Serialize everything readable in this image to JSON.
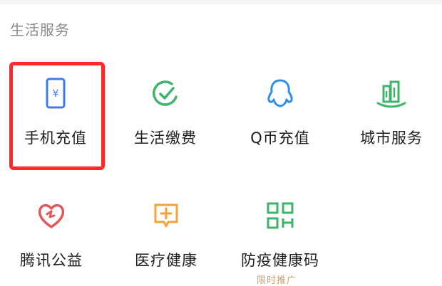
{
  "section": {
    "title": "生活服务"
  },
  "services": [
    {
      "label": "手机充值",
      "icon": "phone-yuan-icon",
      "color": "#3b7cf0"
    },
    {
      "label": "生活缴费",
      "icon": "check-circle-icon",
      "color": "#3fb36a"
    },
    {
      "label": "Q币充值",
      "icon": "qq-penguin-icon",
      "color": "#2f8ee8"
    },
    {
      "label": "城市服务",
      "icon": "city-buildings-icon",
      "color": "#3fb36a"
    },
    {
      "label": "腾讯公益",
      "icon": "charity-heart-icon",
      "color": "#e05a5a"
    },
    {
      "label": "医疗健康",
      "icon": "medical-plus-icon",
      "color": "#f0a33b"
    },
    {
      "label": "防疫健康码",
      "icon": "qr-code-icon",
      "color": "#3fb36a"
    }
  ],
  "highlight_color": "#ff2a2a",
  "sub_label": "限时推广"
}
